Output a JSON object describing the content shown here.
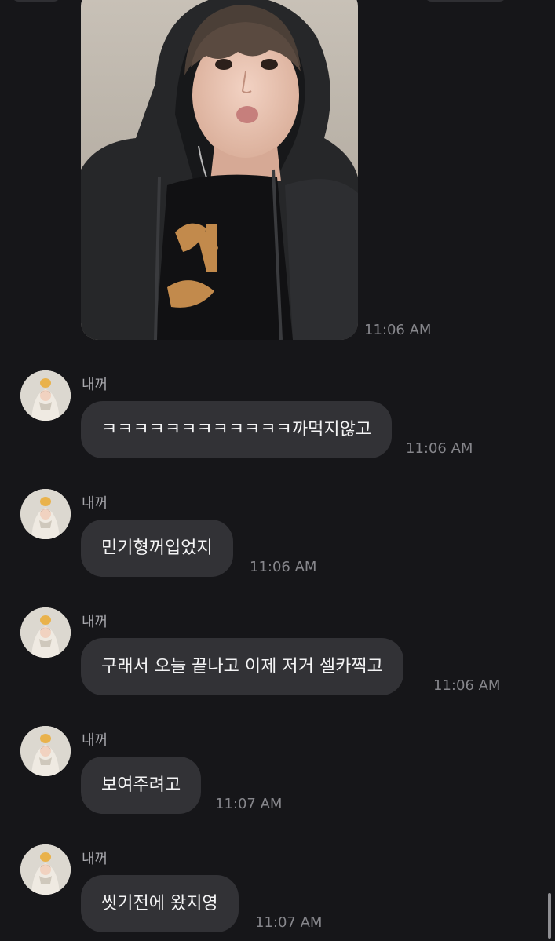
{
  "photo_message": {
    "photo_icon": "selfie-photo",
    "time": "11:06 AM"
  },
  "messages": [
    {
      "sender": "내꺼",
      "avatar_icon": "profile-avatar",
      "text": "ㅋㅋㅋㅋㅋㅋㅋㅋㅋㅋㅋㅋ까먹지않고",
      "time": "11:06 AM"
    },
    {
      "sender": "내꺼",
      "avatar_icon": "profile-avatar",
      "text": "민기형꺼입었지",
      "time": "11:06 AM"
    },
    {
      "sender": "내꺼",
      "avatar_icon": "profile-avatar",
      "text": "구래서 오늘 끝나고 이제 저거 셀카찍고",
      "time": "11:06 AM"
    },
    {
      "sender": "내꺼",
      "avatar_icon": "profile-avatar",
      "text": "보여주려고",
      "time": "11:07 AM"
    },
    {
      "sender": "내꺼",
      "avatar_icon": "profile-avatar",
      "text": "씻기전에 왔지영",
      "time": "11:07 AM"
    }
  ],
  "colors": {
    "background": "#161619",
    "bubble": "#323236",
    "timestamp": "#86868b",
    "sender": "#a8a8ad"
  }
}
